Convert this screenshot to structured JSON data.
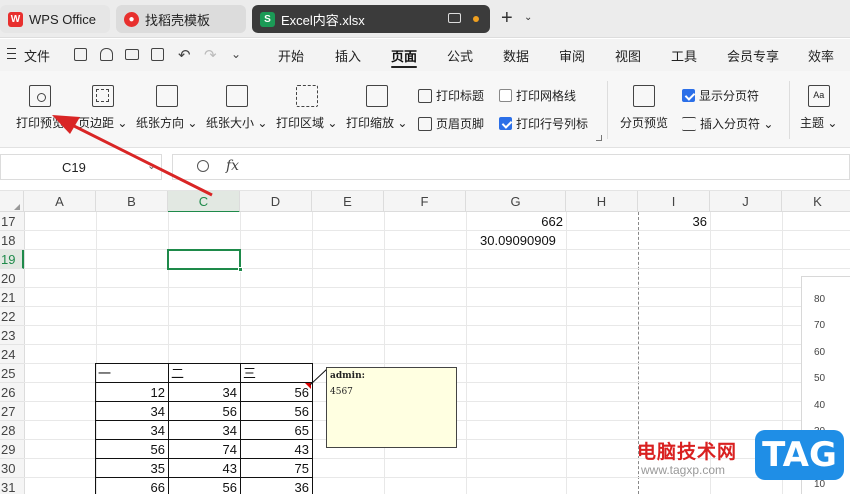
{
  "tabs": {
    "wps": "WPS Office",
    "template": "找稻壳模板",
    "file": "Excel内容.xlsx"
  },
  "menubar": {
    "file": "文件",
    "items": [
      "开始",
      "插入",
      "页面",
      "公式",
      "数据",
      "审阅",
      "视图",
      "工具",
      "会员专享",
      "效率"
    ]
  },
  "ribbon": {
    "print_preview": "打印预览",
    "margins": "页边距",
    "orientation": "纸张方向",
    "size": "纸张大小",
    "print_area": "打印区域",
    "print_scale": "打印缩放",
    "print_titles": "打印标题",
    "header_footer": "页眉页脚",
    "print_gridlines": "打印网格线",
    "print_headings": "打印行号列标",
    "page_break_preview": "分页预览",
    "show_page_breaks": "显示分页符",
    "insert_page_break": "插入分页符",
    "theme": "主题",
    "print_gridlines_checked": false,
    "print_headings_checked": true,
    "show_page_breaks_checked": true
  },
  "formula_bar": {
    "name_box": "C19",
    "fx": "fx",
    "value": ""
  },
  "columns": [
    "A",
    "B",
    "C",
    "D",
    "E",
    "F",
    "G",
    "H",
    "I",
    "J",
    "K"
  ],
  "rows": [
    "17",
    "18",
    "19",
    "20",
    "21",
    "22",
    "23",
    "24",
    "25",
    "26",
    "27",
    "28",
    "29",
    "30",
    "31"
  ],
  "cells": {
    "g17": "662",
    "i17": "36",
    "g18": "30.09090909"
  },
  "table": {
    "headers": [
      "一",
      "二",
      "三"
    ],
    "rows": [
      [
        "12",
        "34",
        "56"
      ],
      [
        "34",
        "56",
        "56"
      ],
      [
        "34",
        "34",
        "65"
      ],
      [
        "56",
        "74",
        "43"
      ],
      [
        "35",
        "43",
        "75"
      ],
      [
        "66",
        "56",
        "36"
      ]
    ]
  },
  "comment": {
    "author": "admin:",
    "text": "4567"
  },
  "chart_axis": [
    "80",
    "70",
    "60",
    "50",
    "40",
    "30",
    "20",
    "10"
  ],
  "watermark": {
    "site": "电脑技术网",
    "url": "www.tagxp.com",
    "logo": "TAG"
  }
}
